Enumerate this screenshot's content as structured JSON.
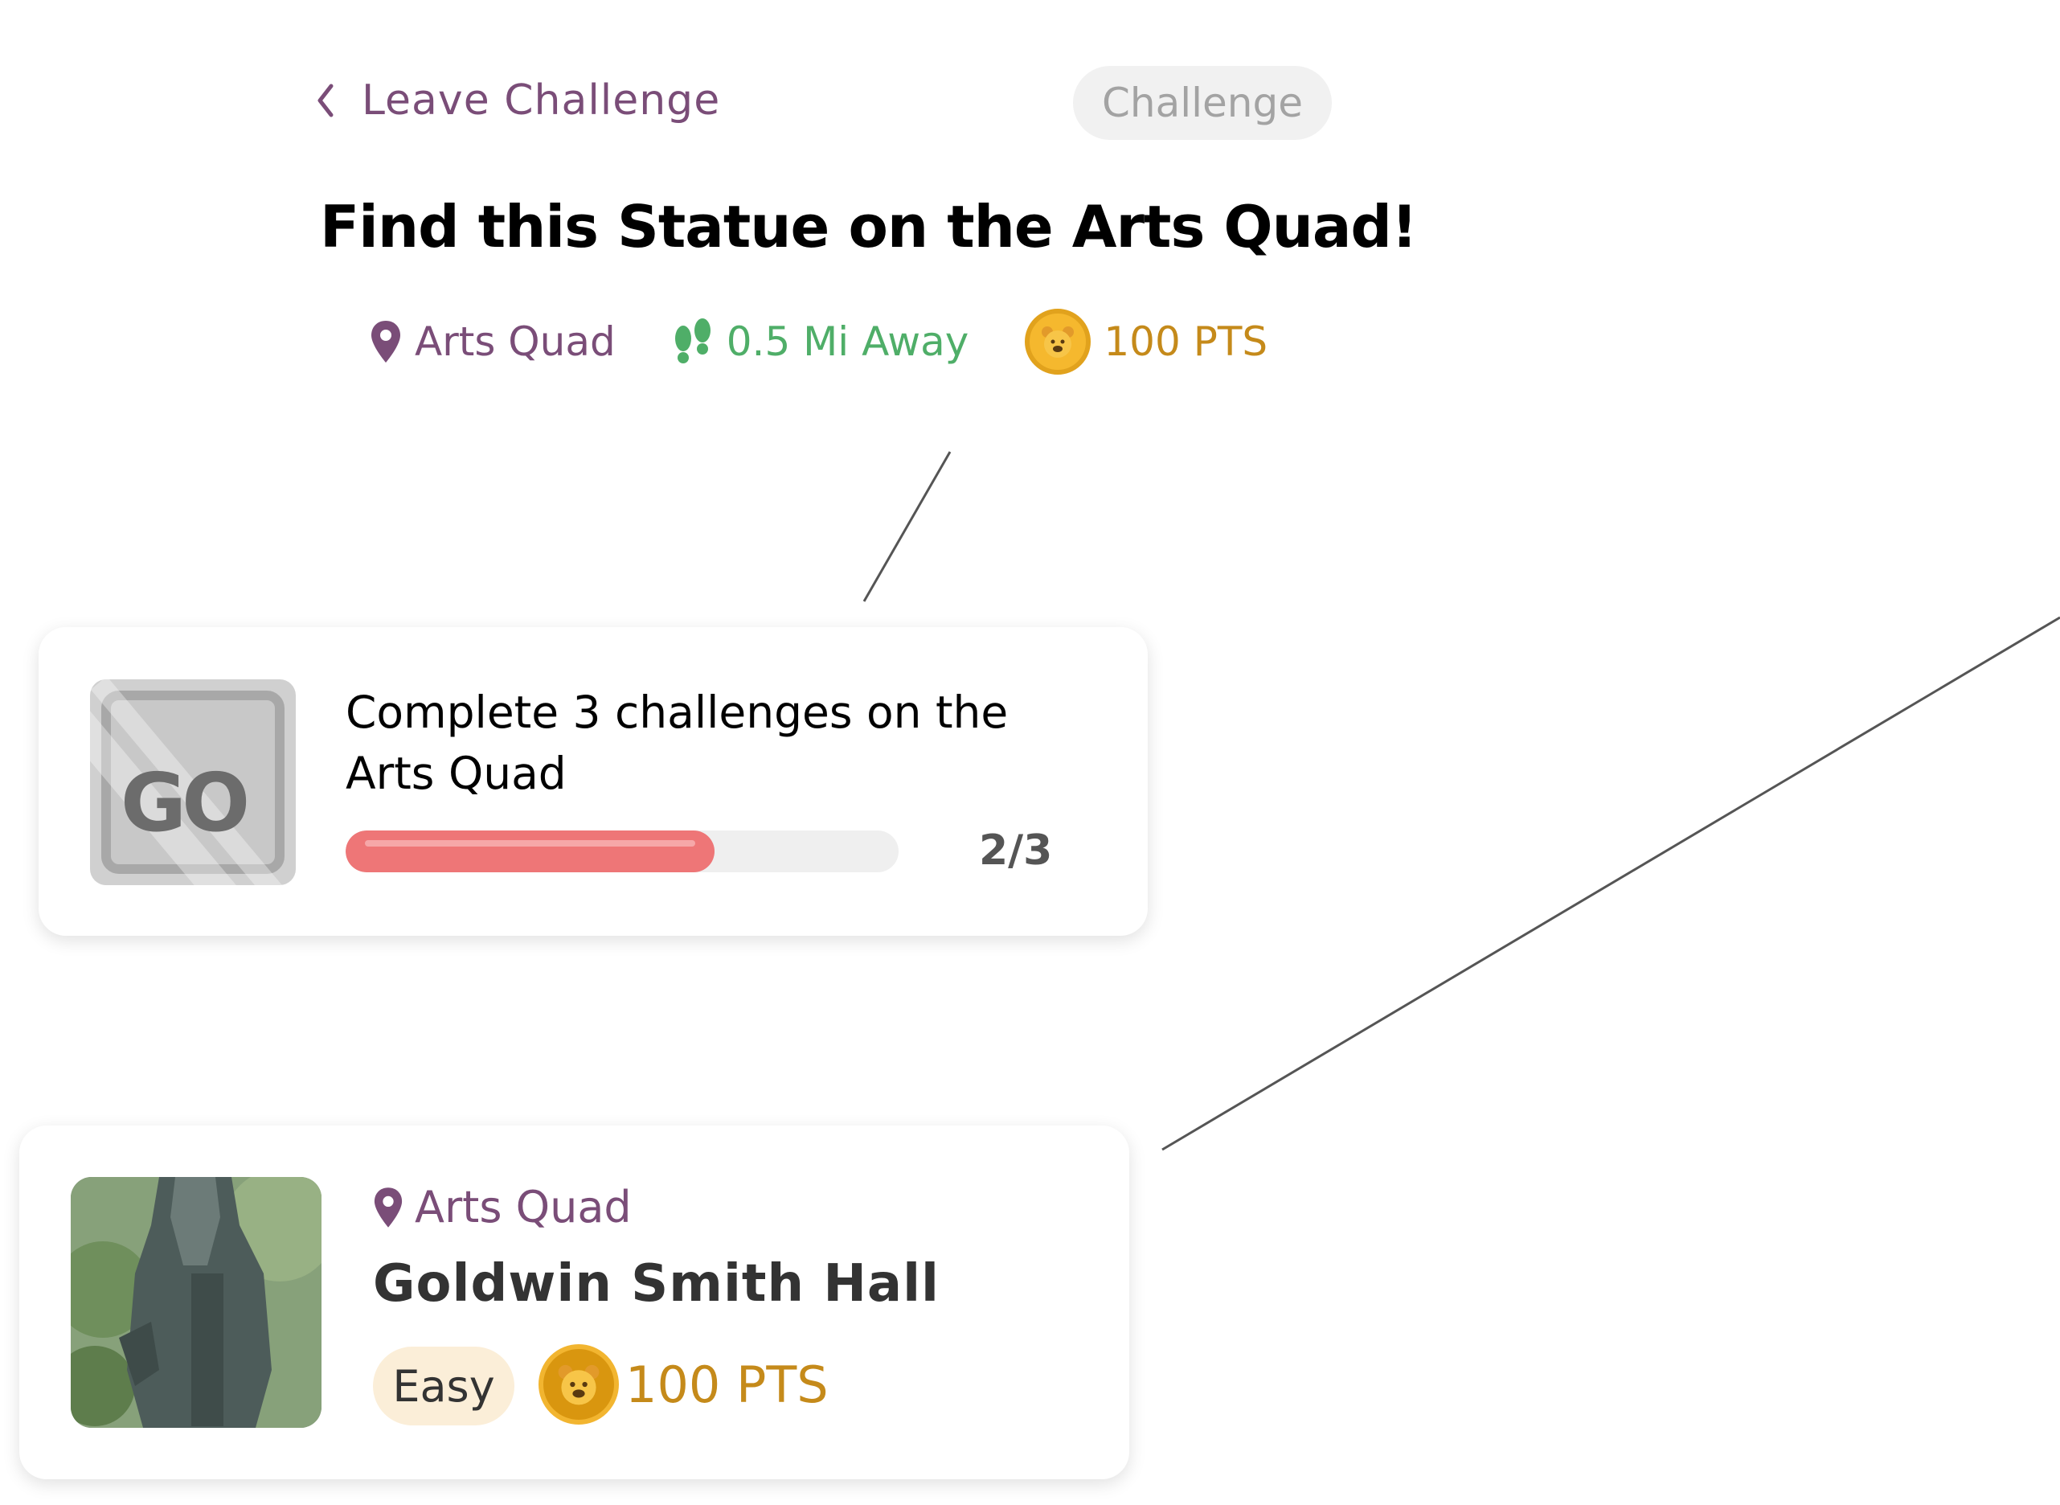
{
  "header": {
    "back_label": "Leave Challenge",
    "type_pill": "Challenge"
  },
  "challenge": {
    "title": "Find this Statue on the Arts Quad!",
    "location": "Arts Quad",
    "distance": "0.5 Mi Away",
    "points": "100 PTS"
  },
  "achievement": {
    "badge_icon": "go-binoculars-badge",
    "description": "Complete 3 challenges on the Arts Quad",
    "progress_current": 2,
    "progress_total": 3,
    "progress_label": "2/3",
    "progress_color": "#ee7677"
  },
  "challenge_card": {
    "location": "Arts Quad",
    "name": "Goldwin Smith Hall",
    "difficulty": "Easy",
    "points": "100 PTS"
  },
  "colors": {
    "accent_purple": "#7a4d78",
    "distance_green": "#4fae68",
    "points_gold": "#c58a1a"
  }
}
